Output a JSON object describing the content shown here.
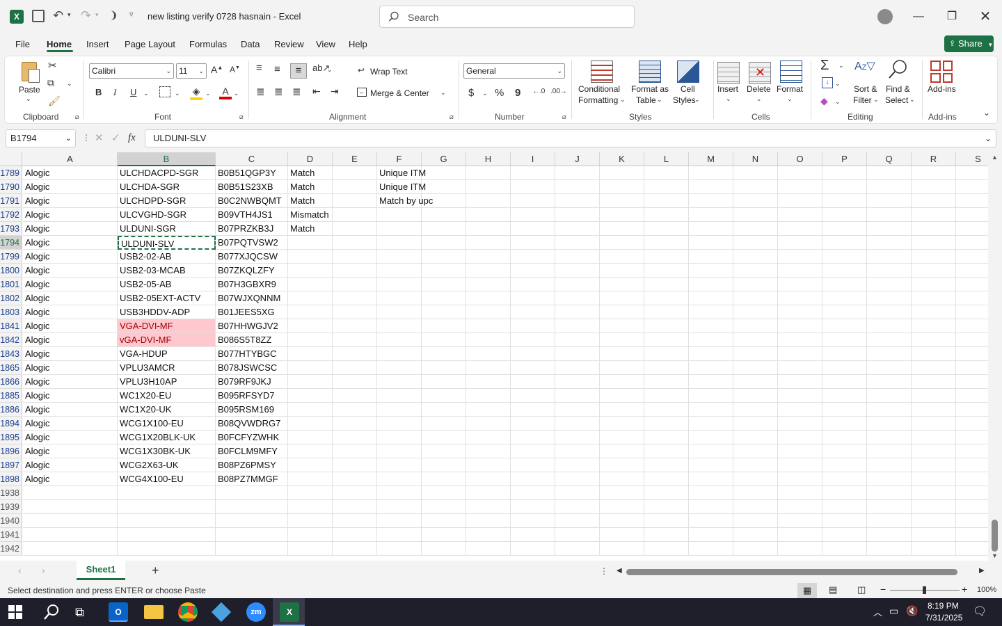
{
  "window": {
    "title": "new listing verify 0728 hasnain  -  Excel",
    "search_placeholder": "Search"
  },
  "menu": {
    "tabs": [
      "File",
      "Home",
      "Insert",
      "Page Layout",
      "Formulas",
      "Data",
      "Review",
      "View",
      "Help"
    ],
    "share_label": "Share"
  },
  "ribbon": {
    "clipboard": {
      "paste": "Paste",
      "label": "Clipboard"
    },
    "font": {
      "name": "Calibri",
      "size": "11",
      "bold": "B",
      "italic": "I",
      "underline": "U",
      "label": "Font"
    },
    "alignment": {
      "wrap_text": "Wrap Text",
      "merge_center": "Merge & Center",
      "label": "Alignment"
    },
    "number": {
      "format": "General",
      "currency": "$",
      "percent": "%",
      "comma": "9",
      "label": "Number"
    },
    "styles": {
      "conditional_1": "Conditional",
      "conditional_2": "Formatting",
      "format_table_1": "Format as",
      "format_table_2": "Table",
      "cell_styles_1": "Cell",
      "cell_styles_2": "Styles",
      "label": "Styles"
    },
    "cells": {
      "insert": "Insert",
      "delete": "Delete",
      "format": "Format",
      "label": "Cells"
    },
    "editing": {
      "sort_1": "Sort &",
      "sort_2": "Filter",
      "find_1": "Find &",
      "find_2": "Select",
      "label": "Editing"
    },
    "addins": {
      "addins": "Add-ins",
      "label": "Add-ins"
    }
  },
  "formula_bar": {
    "name_box": "B1794",
    "fx": "fx",
    "content": "ULDUNI-SLV"
  },
  "grid": {
    "columns": [
      "A",
      "B",
      "C",
      "D",
      "E",
      "F",
      "G",
      "H",
      "I",
      "J",
      "K",
      "L",
      "M",
      "N",
      "O",
      "P",
      "Q",
      "R",
      "S"
    ],
    "rows": [
      {
        "num": "1789",
        "a": "Alogic",
        "b": "ULCHDACPD-SGR",
        "c": "B0B51QGP3Y",
        "d": "Match",
        "f": "Unique ITM"
      },
      {
        "num": "1790",
        "a": "Alogic",
        "b": "ULCHDA-SGR",
        "c": "B0B51S23XB",
        "d": "Match",
        "f": "Unique ITM"
      },
      {
        "num": "1791",
        "a": "Alogic",
        "b": "ULCHDPD-SGR",
        "c": "B0C2NWBQMT",
        "d": "Match",
        "f": "Match by upc"
      },
      {
        "num": "1792",
        "a": "Alogic",
        "b": "ULCVGHD-SGR",
        "c": "B09VTH4JS1",
        "d": "Mismatch",
        "f": ""
      },
      {
        "num": "1793",
        "a": "Alogic",
        "b": "ULDUNI-SGR",
        "c": "B07PRZKB3J",
        "d": "Match",
        "f": ""
      },
      {
        "num": "1794",
        "a": "Alogic",
        "b": "ULDUNI-SLV",
        "c": "B07PQTVSW2",
        "d": "",
        "f": ""
      },
      {
        "num": "1799",
        "a": "Alogic",
        "b": "USB2-02-AB",
        "c": "B077XJQCSW",
        "d": "",
        "f": ""
      },
      {
        "num": "1800",
        "a": "Alogic",
        "b": "USB2-03-MCAB",
        "c": "B07ZKQLZFY",
        "d": "",
        "f": ""
      },
      {
        "num": "1801",
        "a": "Alogic",
        "b": "USB2-05-AB",
        "c": "B07H3GBXR9",
        "d": "",
        "f": ""
      },
      {
        "num": "1802",
        "a": "Alogic",
        "b": "USB2-05EXT-ACTV",
        "c": "B07WJXQNNM",
        "d": "",
        "f": ""
      },
      {
        "num": "1803",
        "a": "Alogic",
        "b": "USB3HDDV-ADP",
        "c": "B01JEES5XG",
        "d": "",
        "f": ""
      },
      {
        "num": "1841",
        "a": "Alogic",
        "b": "VGA-DVI-MF",
        "c": "B07HHWGJV2",
        "d": "",
        "f": "",
        "pink": true
      },
      {
        "num": "1842",
        "a": "Alogic",
        "b": "vGA-DVI-MF",
        "c": "B086S5T8ZZ",
        "d": "",
        "f": "",
        "pink": true
      },
      {
        "num": "1843",
        "a": "Alogic",
        "b": "VGA-HDUP",
        "c": "B077HTYBGC",
        "d": "",
        "f": ""
      },
      {
        "num": "1865",
        "a": "Alogic",
        "b": "VPLU3AMCR",
        "c": "B078JSWCSC",
        "d": "",
        "f": ""
      },
      {
        "num": "1866",
        "a": "Alogic",
        "b": "VPLU3H10AP",
        "c": "B079RF9JKJ",
        "d": "",
        "f": ""
      },
      {
        "num": "1885",
        "a": "Alogic",
        "b": "WC1X20-EU",
        "c": "B095RFSYD7",
        "d": "",
        "f": ""
      },
      {
        "num": "1886",
        "a": "Alogic",
        "b": "WC1X20-UK",
        "c": "B095RSM169",
        "d": "",
        "f": ""
      },
      {
        "num": "1894",
        "a": "Alogic",
        "b": "WCG1X100-EU",
        "c": "B08QVWDRG7",
        "d": "",
        "f": ""
      },
      {
        "num": "1895",
        "a": "Alogic",
        "b": "WCG1X20BLK-UK",
        "c": "B0FCFYZWHK",
        "d": "",
        "f": ""
      },
      {
        "num": "1896",
        "a": "Alogic",
        "b": "WCG1X30BK-UK",
        "c": "B0FCLM9MFY",
        "d": "",
        "f": ""
      },
      {
        "num": "1897",
        "a": "Alogic",
        "b": "WCG2X63-UK",
        "c": "B08PZ6PMSY",
        "d": "",
        "f": ""
      },
      {
        "num": "1898",
        "a": "Alogic",
        "b": "WCG4X100-EU",
        "c": "B08PZ7MMGF",
        "d": "",
        "f": ""
      },
      {
        "num": "1938",
        "a": "",
        "b": "",
        "c": "",
        "d": "",
        "f": "",
        "empty": true
      },
      {
        "num": "1939",
        "a": "",
        "b": "",
        "c": "",
        "d": "",
        "f": "",
        "empty": true
      },
      {
        "num": "1940",
        "a": "",
        "b": "",
        "c": "",
        "d": "",
        "f": "",
        "empty": true
      },
      {
        "num": "1941",
        "a": "",
        "b": "",
        "c": "",
        "d": "",
        "f": "",
        "empty": true
      },
      {
        "num": "1942",
        "a": "",
        "b": "",
        "c": "",
        "d": "",
        "f": "",
        "empty": true
      }
    ],
    "selected_row": "1794",
    "selected_col": "B"
  },
  "sheets": {
    "active": "Sheet1",
    "add": "+"
  },
  "status": {
    "message": "Select destination and press ENTER or choose Paste",
    "zoom": "100%"
  },
  "taskbar": {
    "time": "8:19 PM",
    "date": "7/31/2025"
  },
  "colors": {
    "excel_green": "#1e7145",
    "pink_fill": "#ffc7ce",
    "pink_text": "#9c0006"
  }
}
